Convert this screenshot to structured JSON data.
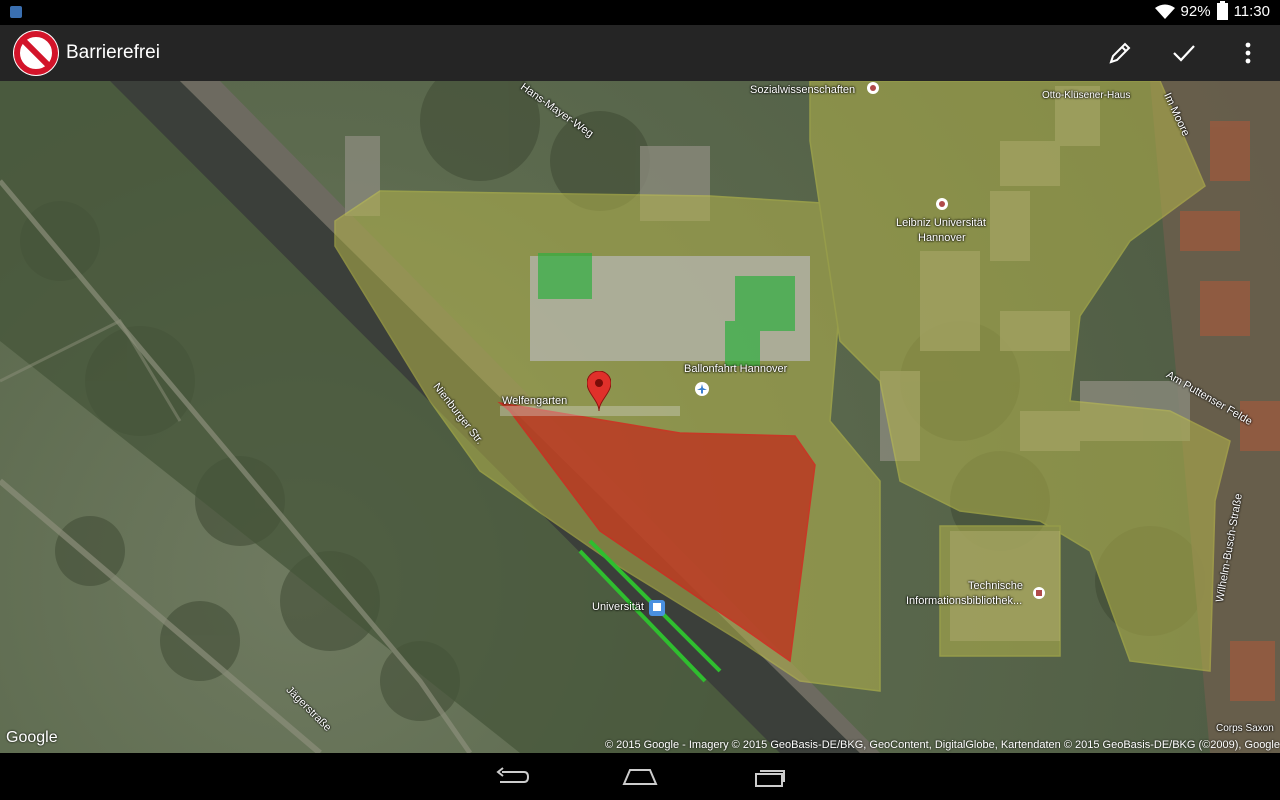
{
  "status": {
    "battery": "92%",
    "time": "11:30"
  },
  "app": {
    "title": "Barrierefrei"
  },
  "map_labels": {
    "sozialwissenschaften": "Sozialwissenschaften",
    "otto": "Otto-Klüsener-Haus",
    "hans_mayer": "Hans-Mayer-Weg",
    "im_moore": "Im Moore",
    "leibniz": "Leibniz Universität",
    "hannover": "Hannover",
    "ballonfahrt": "Ballonfahrt Hannover",
    "welfengarten": "Welfengarten",
    "nienburger": "Nienburger Str.",
    "am_puttenser": "Am Puttenser Felde",
    "wilhelm_busch": "Wilhelm-Busch-Straße",
    "technische": "Technische",
    "informationsbibliothek": "Informationsbibliothek...",
    "universitat": "Universität",
    "jagerstrasse": "Jägerstraße",
    "corps": "Corps Saxon"
  },
  "attribution": "© 2015 Google - Imagery © 2015 GeoBasis-DE/BKG, GeoContent, DigitalGlobe, Kartendaten © 2015 GeoBasis-DE/BKG (©2009), Google",
  "google_logo": "Google",
  "colors": {
    "red_area": "#c0311f",
    "yellow_area": "#b4b44c",
    "green_area": "#2fae3f",
    "actionbar": "#252525"
  }
}
